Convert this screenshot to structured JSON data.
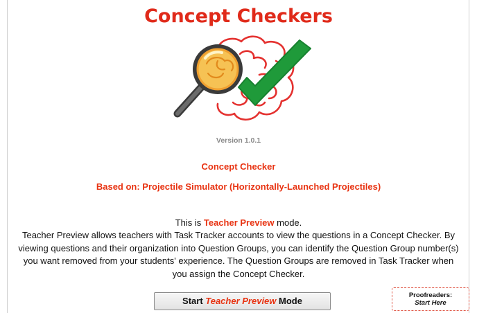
{
  "header": {
    "title": "Concept Checkers",
    "logo_icon": "magnifier-brain-checkmark-icon"
  },
  "version": "Version 1.0.1",
  "concept_checker": {
    "label": "Concept Checker",
    "based_on": "Based on: Projectile Simulator (Horizontally-Launched Projectiles)"
  },
  "preview": {
    "mode_prefix": "This is ",
    "mode_name": "Teacher Preview",
    "mode_suffix": " mode.",
    "description": "Teacher Preview allows teachers with Task Tracker accounts to view the questions in a Concept Checker. By viewing questions and their organization into Question Groups, you can identify the Question Group number(s) you want removed from your students' experience. The Question Groups are removed in Task Tracker when you assign the Concept Checker."
  },
  "start_button": {
    "prefix": "Start ",
    "highlight": "Teacher Preview",
    "suffix": " Mode"
  },
  "proofreaders": {
    "line1": "Proofreaders:",
    "line2": "Start Here"
  },
  "colors": {
    "accent": "#e83312",
    "title": "#e02a1a",
    "check": "#1f9a3a",
    "brain": "#e4312f"
  }
}
